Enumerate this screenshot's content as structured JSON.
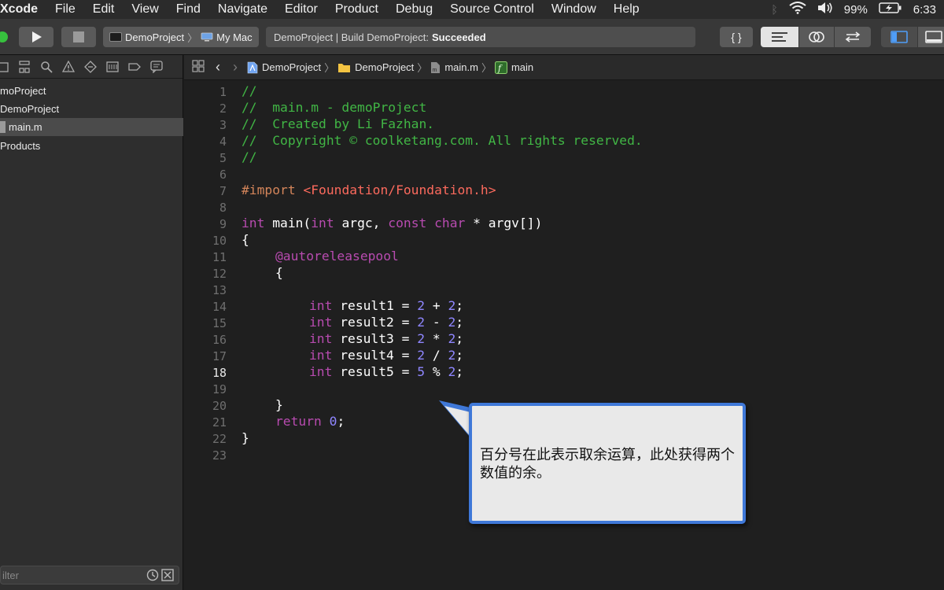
{
  "menubar": {
    "app": "Xcode",
    "menus": [
      "File",
      "Edit",
      "View",
      "Find",
      "Navigate",
      "Editor",
      "Product",
      "Debug",
      "Source Control",
      "Window",
      "Help"
    ],
    "battery": "99%",
    "time": "6:33"
  },
  "toolbar": {
    "scheme_name": "DemoProject",
    "destination": "My Mac",
    "activity_prefix": "DemoProject | Build DemoProject:",
    "activity_status": "Succeeded",
    "braces_label": "{ }"
  },
  "navigator": {
    "items": [
      {
        "label": "moProject"
      },
      {
        "label": "DemoProject"
      },
      {
        "label": "main.m"
      },
      {
        "label": "Products"
      }
    ],
    "filter_placeholder": "ilter"
  },
  "jumpbar": {
    "crumbs": [
      "DemoProject",
      "DemoProject",
      "main.m",
      "main"
    ]
  },
  "editor": {
    "current_line": 18,
    "lines": [
      {
        "n": "1"
      },
      {
        "n": "2"
      },
      {
        "n": "3"
      },
      {
        "n": "4"
      },
      {
        "n": "5"
      },
      {
        "n": "6"
      },
      {
        "n": "7"
      },
      {
        "n": "8"
      },
      {
        "n": "9"
      },
      {
        "n": "10"
      },
      {
        "n": "11"
      },
      {
        "n": "12"
      },
      {
        "n": "13"
      },
      {
        "n": "14"
      },
      {
        "n": "15"
      },
      {
        "n": "16"
      },
      {
        "n": "17"
      },
      {
        "n": "18"
      },
      {
        "n": "19"
      },
      {
        "n": "20"
      },
      {
        "n": "21"
      },
      {
        "n": "22"
      },
      {
        "n": "23"
      }
    ],
    "code": {
      "l1": "//",
      "l2": "//  main.m - demoProject",
      "l3": "//  Created by Li Fazhan.",
      "l4": "//  Copyright © coolketang.com. All rights reserved.",
      "l5": "//",
      "l7_directive": "#import",
      "l7_path": "<Foundation/Foundation.h>",
      "l9_int": "int",
      "l9_main": " main(",
      "l9_int2": "int",
      "l9_argc": " argc, ",
      "l9_const": "const",
      "l9_char": "char",
      "l9_argv": " * argv[])",
      "l10": "{",
      "l11": "@autoreleasepool",
      "l12": "{",
      "l14_var": " result1 = ",
      "l14_a": "2",
      "l14_op": " + ",
      "l14_b": "2",
      "l15_var": " result2 = ",
      "l15_a": "2",
      "l15_op": " - ",
      "l15_b": "2",
      "l16_var": " result3 = ",
      "l16_a": "2",
      "l16_op": " * ",
      "l16_b": "2",
      "l17_var": " result4 = ",
      "l17_a": "2",
      "l17_op": " / ",
      "l17_b": "2",
      "l18_var": " result5 = ",
      "l18_a": "5",
      "l18_op": " % ",
      "l18_b": "2",
      "int_kw": "int",
      "semi": ";",
      "l20": "}",
      "l21_return": "return",
      "l21_zero": "0",
      "l22": "}"
    }
  },
  "callout": {
    "text": "百分号在此表示取余运算，此处获得两个数值的余。"
  },
  "colors": {
    "comment": "#41b645",
    "keyword": "#b84bb0",
    "number": "#8f86ff",
    "string": "#fc6a5d",
    "directive": "#d4855a",
    "callout_border": "#3f78d8"
  }
}
